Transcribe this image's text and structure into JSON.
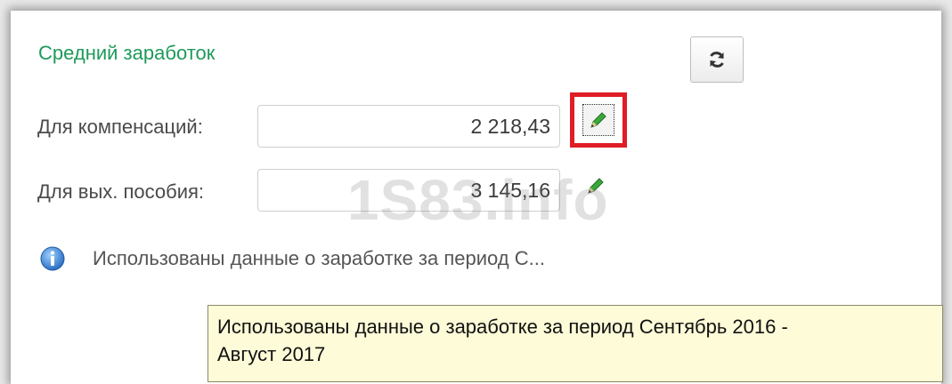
{
  "section": {
    "title": "Средний заработок"
  },
  "refresh_button": {
    "icon": "refresh-icon"
  },
  "fields": [
    {
      "label": "Для компенсаций:",
      "value": "2 218,43",
      "edit_icon": "pencil-icon"
    },
    {
      "label": "Для вых. пособия:",
      "value": "3 145,16",
      "edit_icon": "pencil-icon"
    }
  ],
  "info": {
    "icon": "info-icon",
    "text": "Использованы данные о заработке за период С..."
  },
  "tooltip": {
    "line1": "Использованы данные о заработке за период Сентябрь 2016 -",
    "line2": "Август 2017"
  },
  "watermark": "1S83.info",
  "colors": {
    "title": "#1e9a5a",
    "highlight": "#e01c24",
    "tooltip_bg": "#fdfbd8"
  }
}
